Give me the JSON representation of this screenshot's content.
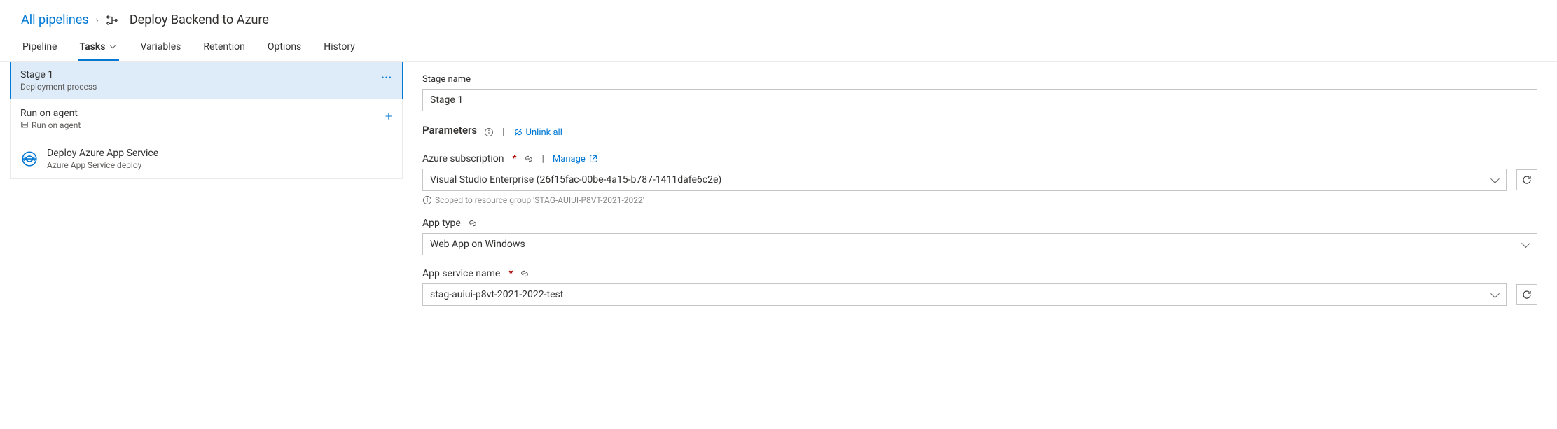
{
  "breadcrumb": {
    "root": "All pipelines",
    "title": "Deploy Backend to Azure"
  },
  "tabs": {
    "pipeline": "Pipeline",
    "tasks": "Tasks",
    "variables": "Variables",
    "retention": "Retention",
    "options": "Options",
    "history": "History"
  },
  "left": {
    "stage": {
      "name": "Stage 1",
      "sub": "Deployment process"
    },
    "agent": {
      "title": "Run on agent",
      "sub": "Run on agent"
    },
    "task": {
      "title": "Deploy Azure App Service",
      "sub": "Azure App Service deploy"
    }
  },
  "right": {
    "stage_name": {
      "label": "Stage name",
      "value": "Stage 1"
    },
    "parameters": {
      "title": "Parameters",
      "unlink": "Unlink all"
    },
    "subscription": {
      "label": "Azure subscription",
      "manage": "Manage",
      "value": "Visual Studio Enterprise (26f15fac-00be-4a15-b787-1411dafe6c2e)",
      "note": "Scoped to resource group 'STAG-AUIUI-P8VT-2021-2022'"
    },
    "app_type": {
      "label": "App type",
      "value": "Web App on Windows"
    },
    "app_service": {
      "label": "App service name",
      "value": "stag-auiui-p8vt-2021-2022-test"
    }
  }
}
